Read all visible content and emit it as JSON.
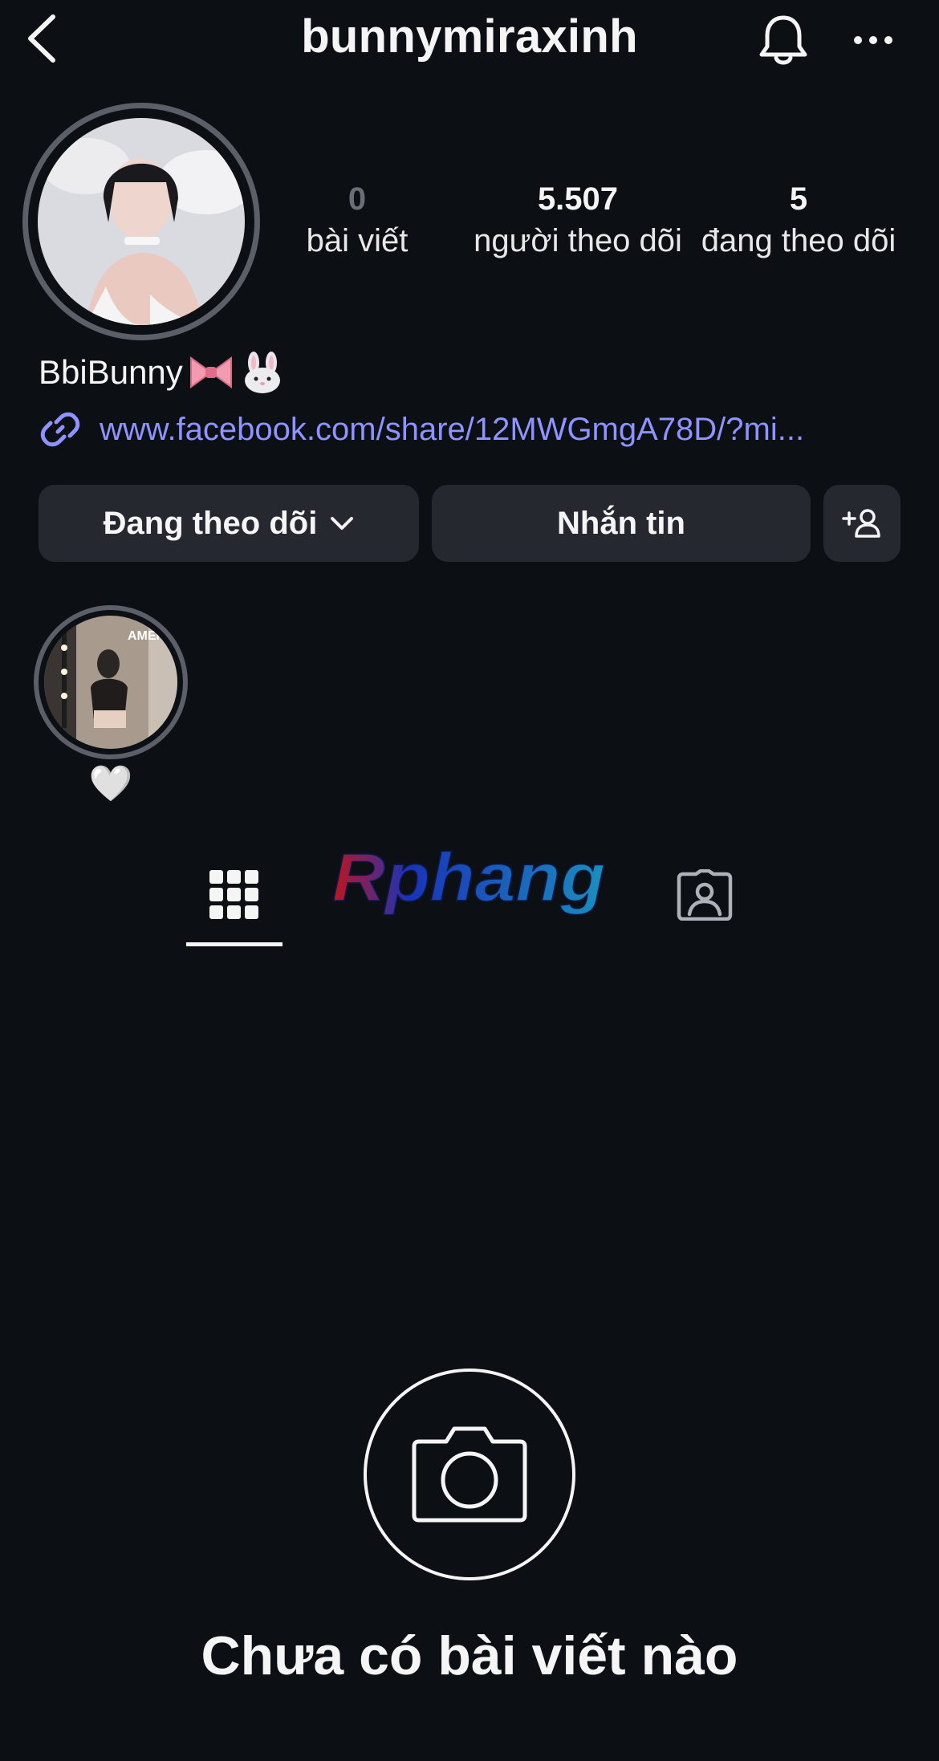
{
  "header": {
    "username": "bunnymiraxinh",
    "back_icon": "chevron-left-icon",
    "bell_icon": "bell-icon",
    "more_icon": "more-horizontal-icon"
  },
  "profile": {
    "avatar_icon": "profile-photo",
    "stats": [
      {
        "value": "0",
        "label": "bài viết"
      },
      {
        "value": "5.507",
        "label": "người theo dõi"
      },
      {
        "value": "5",
        "label": "đang theo dõi"
      }
    ],
    "display_name": "BbiBunny",
    "name_emojis": [
      "ribbon-emoji",
      "rabbit-emoji"
    ],
    "link": "www.facebook.com/share/12MWGmgA78D/?mi...",
    "link_color": "#8e93ff"
  },
  "actions": {
    "follow_label": "Đang theo dõi",
    "message_label": "Nhắn tin",
    "add_user_icon": "add-user-icon"
  },
  "highlights": [
    {
      "label": "🤍",
      "cover_text": "AMEN"
    }
  ],
  "tabs": {
    "active": "grid",
    "items": [
      "grid-icon",
      "tagged-icon"
    ]
  },
  "watermark": {
    "text": "Rphang"
  },
  "empty_state": {
    "icon": "camera-icon",
    "title": "Chưa có bài viết nào"
  }
}
